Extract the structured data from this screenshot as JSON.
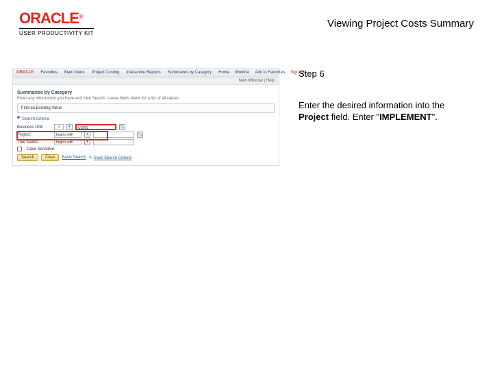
{
  "header": {
    "brand": "ORACLE",
    "subbrand": "USER PRODUCTIVITY KIT",
    "title": "Viewing Project Costs Summary"
  },
  "step": {
    "label": "Step 6",
    "line1": "Enter the desired information into the ",
    "bold1": "Project",
    "line2": " field. Enter \"",
    "bold2": "IMPLEMENT",
    "line3": "\"."
  },
  "sim": {
    "orb": "ORACLE",
    "nav": [
      "Favorites",
      "Main Menu",
      "Project Costing",
      "Interactive Reports",
      "Summaries by Category"
    ],
    "right": [
      "Home",
      "Worklist",
      "Add to Favorites"
    ],
    "signout": "Sign out",
    "sub": "New Window | Help",
    "heading": "Summaries by Category",
    "desc": "Enter any information you have and click Search. Leave fields blank for a list of all values.",
    "find": "Find an Existing Value",
    "criteria": "Search Criteria",
    "fields": {
      "bu_label": "Business Unit:",
      "bu_val": "US001",
      "op": "=",
      "proj_label": "Project:",
      "proj_val": "begins with",
      "tree_label": "Tree Name:",
      "tree_val": "begins with"
    },
    "case": "Case Sensitive",
    "buttons": {
      "search": "Search",
      "clear": "Clear"
    },
    "links": {
      "basic": "Basic Search",
      "save": "Save Search Criteria"
    }
  }
}
